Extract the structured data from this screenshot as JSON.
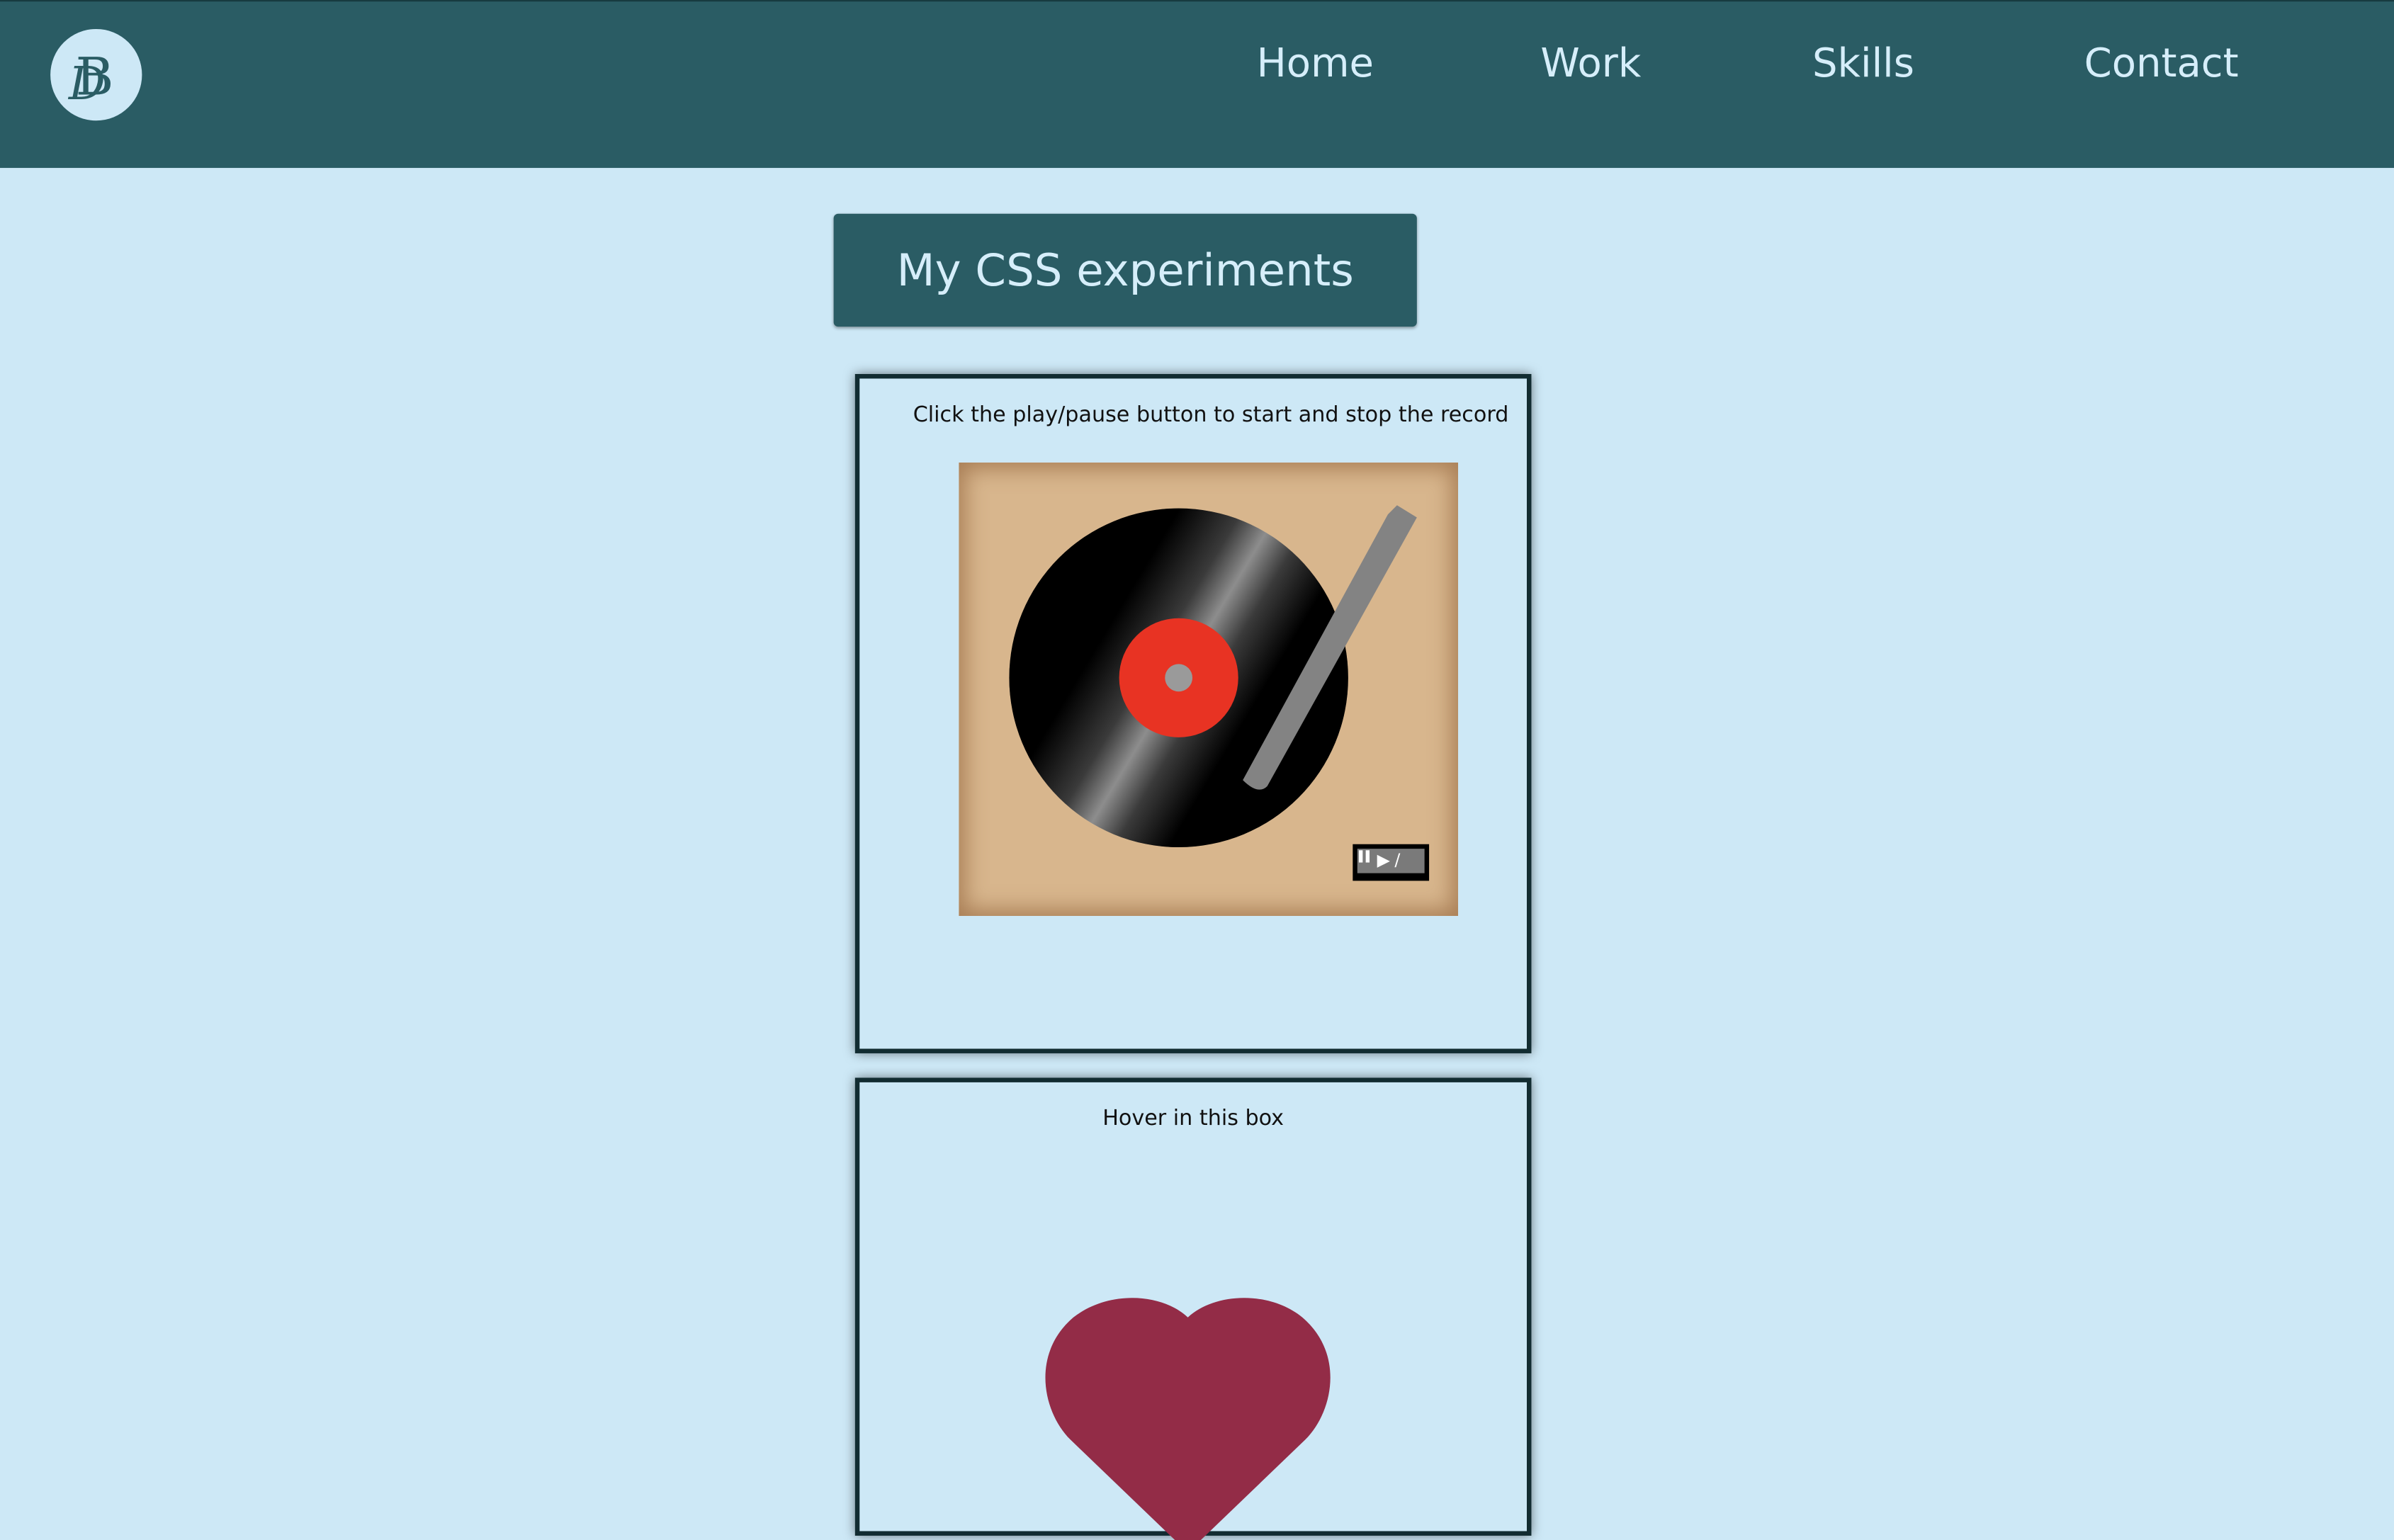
{
  "nav": {
    "logo_alt": "DB",
    "links": [
      "Home",
      "Work",
      "Skills",
      "Contact"
    ]
  },
  "page": {
    "title": "My CSS experiments"
  },
  "experiments": {
    "record": {
      "caption": "Click the play/pause button to start and stop the record",
      "play_symbol": "▶",
      "separator": "/",
      "pause_symbol": "⏸"
    },
    "heart": {
      "caption": "Hover in this box"
    }
  },
  "colors": {
    "header": "#2a5c64",
    "background": "#cde8f6",
    "record_label": "#e83323",
    "heart": "#932c47",
    "turntable": "#d8b68d"
  }
}
